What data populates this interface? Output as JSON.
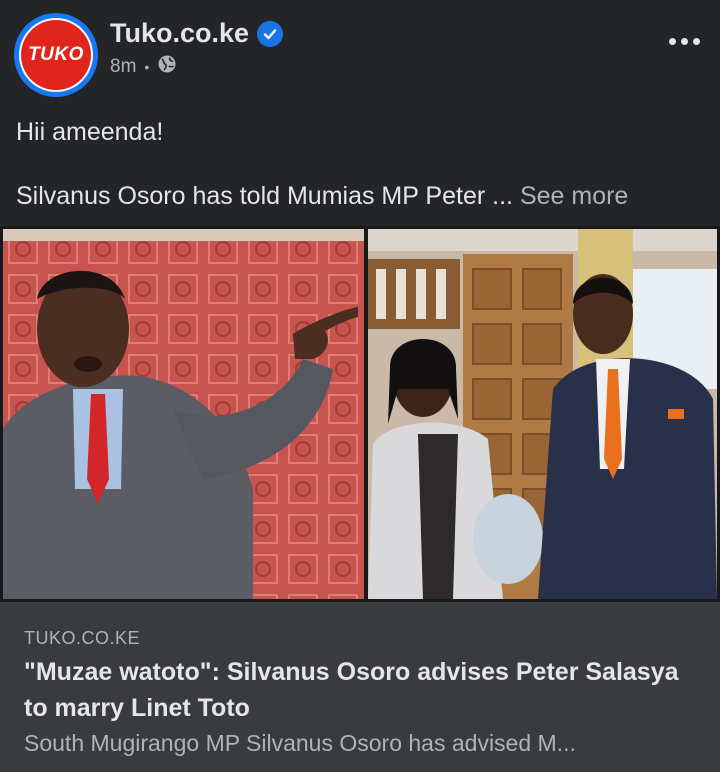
{
  "post": {
    "page_name": "Tuko.co.ke",
    "avatar_text": "TUKO",
    "time": "8m",
    "audience_icon": "globe-icon",
    "text_line1": "Hii ameenda!",
    "text_line2": "Silvanus Osoro has told Mumias MP Peter",
    "ellipsis": "...",
    "see_more": "See more"
  },
  "link_card": {
    "domain": "TUKO.CO.KE",
    "headline": "\"Muzae watoto\": Silvanus Osoro advises Peter Salasya to marry Linet Toto",
    "description": "South Mugirango MP Silvanus Osoro has advised M..."
  },
  "colors": {
    "background": "#242526",
    "card": "#3a3b3c",
    "verified": "#1b74e4",
    "brand_red": "#e0261c"
  }
}
